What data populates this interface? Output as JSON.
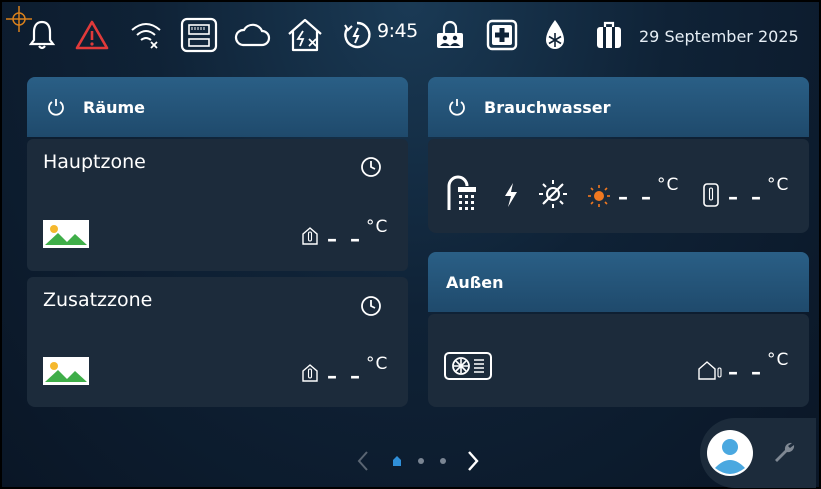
{
  "statusbar": {
    "time": "9:45",
    "date": "29 September 2025",
    "icons": [
      "bell-icon",
      "warning-icon",
      "wifi-off-icon",
      "network-module-icon",
      "cloud-icon",
      "home-smart-grid-off-icon",
      "timer-icon",
      "lock-user-icon",
      "first-aid-icon",
      "defrost-icon",
      "suitcase-icon"
    ]
  },
  "raeume": {
    "title": "Räume",
    "zones": [
      {
        "name": "Hauptzone",
        "temp": "– –",
        "unit": "°C"
      },
      {
        "name": "Zusatzzone",
        "temp": "– –",
        "unit": "°C"
      }
    ]
  },
  "brauchwasser": {
    "title": "Brauchwasser",
    "temp_solar": "– –",
    "unit_solar": "°C",
    "temp_tank": "– –",
    "unit_tank": "°C"
  },
  "aussen": {
    "title": "Außen",
    "temp": "– –",
    "unit": "°C"
  },
  "pager": {
    "pages": 3,
    "current": 1
  },
  "colors": {
    "accent": "#2a5f86",
    "card": "#1c2b3b",
    "warning": "#e03a3a",
    "sun": "#f07820",
    "pager_active": "#2f8fd8",
    "avatar": "#4aa8e0"
  }
}
